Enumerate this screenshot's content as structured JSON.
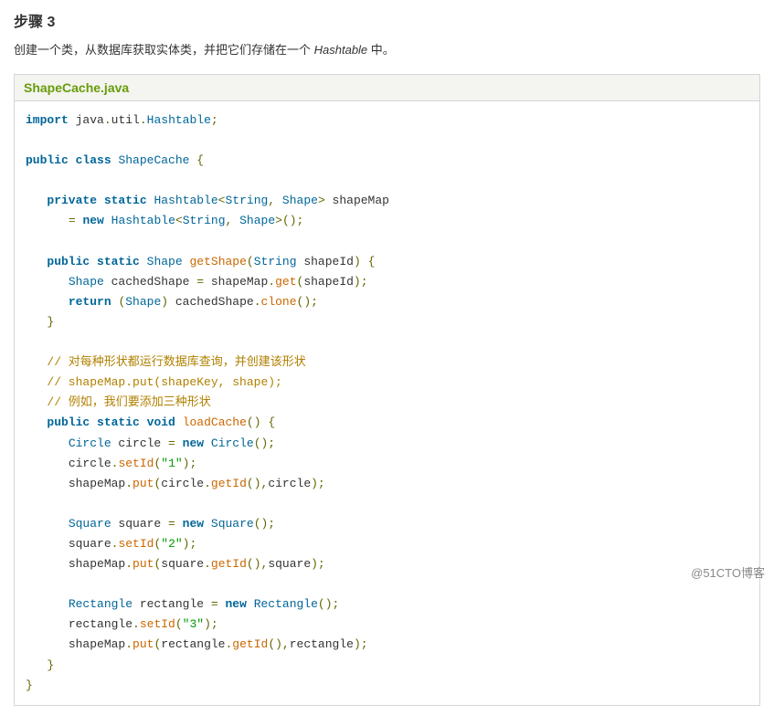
{
  "step": {
    "heading": "步骤 3",
    "description_pre": "创建一个类，从数据库获取实体类，并把它们存储在一个 ",
    "description_em": "Hashtable",
    "description_post": " 中。"
  },
  "file": {
    "name": "ShapeCache.java"
  },
  "code": {
    "l1_kw1": "import",
    "l1_pln": " java",
    "l1_p1": ".",
    "l1_pln2": "util",
    "l1_p2": ".",
    "l1_typ": "Hashtable",
    "l1_p3": ";",
    "l3_kw1": "public",
    "l3_kw2": "class",
    "l3_typ": "ShapeCache",
    "l3_p1": "{",
    "l5_kw1": "private",
    "l5_kw2": "static",
    "l5_typ1": "Hashtable",
    "l5_p1": "<",
    "l5_typ2": "String",
    "l5_p2": ",",
    "l5_typ3": "Shape",
    "l5_p3": ">",
    "l5_pln": " shapeMap ",
    "l6_p1": "=",
    "l6_kw1": "new",
    "l6_typ1": "Hashtable",
    "l6_p2": "<",
    "l6_typ2": "String",
    "l6_p3": ",",
    "l6_typ3": "Shape",
    "l6_p4": ">();",
    "l8_kw1": "public",
    "l8_kw2": "static",
    "l8_typ1": "Shape",
    "l8_mth": "getShape",
    "l8_p1": "(",
    "l8_typ2": "String",
    "l8_pln": " shapeId",
    "l8_p2": ")",
    "l8_p3": "{",
    "l9_typ": "Shape",
    "l9_pln1": " cachedShape ",
    "l9_p1": "=",
    "l9_pln2": " shapeMap",
    "l9_p2": ".",
    "l9_mth": "get",
    "l9_p3": "(",
    "l9_pln3": "shapeId",
    "l9_p4": ");",
    "l10_kw": "return",
    "l10_p1": "(",
    "l10_typ": "Shape",
    "l10_p2": ")",
    "l10_pln": " cachedShape",
    "l10_p3": ".",
    "l10_mth": "clone",
    "l10_p4": "();",
    "l11_p": "}",
    "c1": "// 对每种形状都运行数据库查询，并创建该形状",
    "c2": "// shapeMap.put(shapeKey, shape);",
    "c3": "// 例如，我们要添加三种形状",
    "l16_kw1": "public",
    "l16_kw2": "static",
    "l16_kw3": "void",
    "l16_mth": "loadCache",
    "l16_p1": "()",
    "l16_p2": "{",
    "l17_typ": "Circle",
    "l17_pln": " circle ",
    "l17_p1": "=",
    "l17_kw": "new",
    "l17_typ2": "Circle",
    "l17_p2": "();",
    "l18_pln": "circle",
    "l18_p1": ".",
    "l18_mth": "setId",
    "l18_p2": "(",
    "l18_str": "\"1\"",
    "l18_p3": ");",
    "l19_pln": "shapeMap",
    "l19_p1": ".",
    "l19_mth": "put",
    "l19_p2": "(",
    "l19_pln2": "circle",
    "l19_p3": ".",
    "l19_mth2": "getId",
    "l19_p4": "(),",
    "l19_pln3": "circle",
    "l19_p5": ");",
    "l21_typ": "Square",
    "l21_pln": " square ",
    "l21_p1": "=",
    "l21_kw": "new",
    "l21_typ2": "Square",
    "l21_p2": "();",
    "l22_pln": "square",
    "l22_p1": ".",
    "l22_mth": "setId",
    "l22_p2": "(",
    "l22_str": "\"2\"",
    "l22_p3": ");",
    "l23_pln": "shapeMap",
    "l23_p1": ".",
    "l23_mth": "put",
    "l23_p2": "(",
    "l23_pln2": "square",
    "l23_p3": ".",
    "l23_mth2": "getId",
    "l23_p4": "(),",
    "l23_pln3": "square",
    "l23_p5": ");",
    "l25_typ": "Rectangle",
    "l25_pln": " rectangle ",
    "l25_p1": "=",
    "l25_kw": "new",
    "l25_typ2": "Rectangle",
    "l25_p2": "();",
    "l26_pln": "rectangle",
    "l26_p1": ".",
    "l26_mth": "setId",
    "l26_p2": "(",
    "l26_str": "\"3\"",
    "l26_p3": ");",
    "l27_pln": "shapeMap",
    "l27_p1": ".",
    "l27_mth": "put",
    "l27_p2": "(",
    "l27_pln2": "rectangle",
    "l27_p3": ".",
    "l27_mth2": "getId",
    "l27_p4": "(),",
    "l27_pln3": "rectangle",
    "l27_p5": ");",
    "l28_p": "}",
    "l29_p": "}"
  },
  "watermark": "@51CTO博客"
}
